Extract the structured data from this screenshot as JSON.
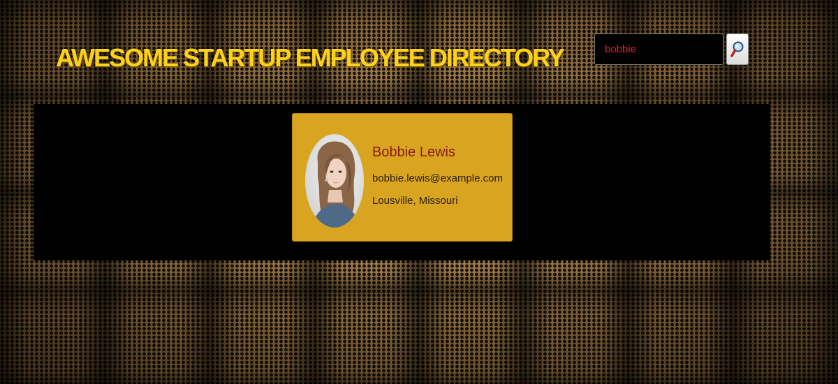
{
  "header": {
    "title": "AWESOME STARTUP EMPLOYEE DIRECTORY"
  },
  "search": {
    "value": "bobbie",
    "button_icon": "magnifier-icon"
  },
  "employees": [
    {
      "name": "Bobbie Lewis",
      "email": "bobbie.lewis@example.com",
      "location": "Lousville, Missouri",
      "avatar_icon": "avatar-photo"
    }
  ],
  "colors": {
    "title": "#ffd21a",
    "card_background": "#d9a521",
    "name_text": "#8b1a0e",
    "search_text": "#e0202a",
    "gallery_background": "#000000"
  }
}
